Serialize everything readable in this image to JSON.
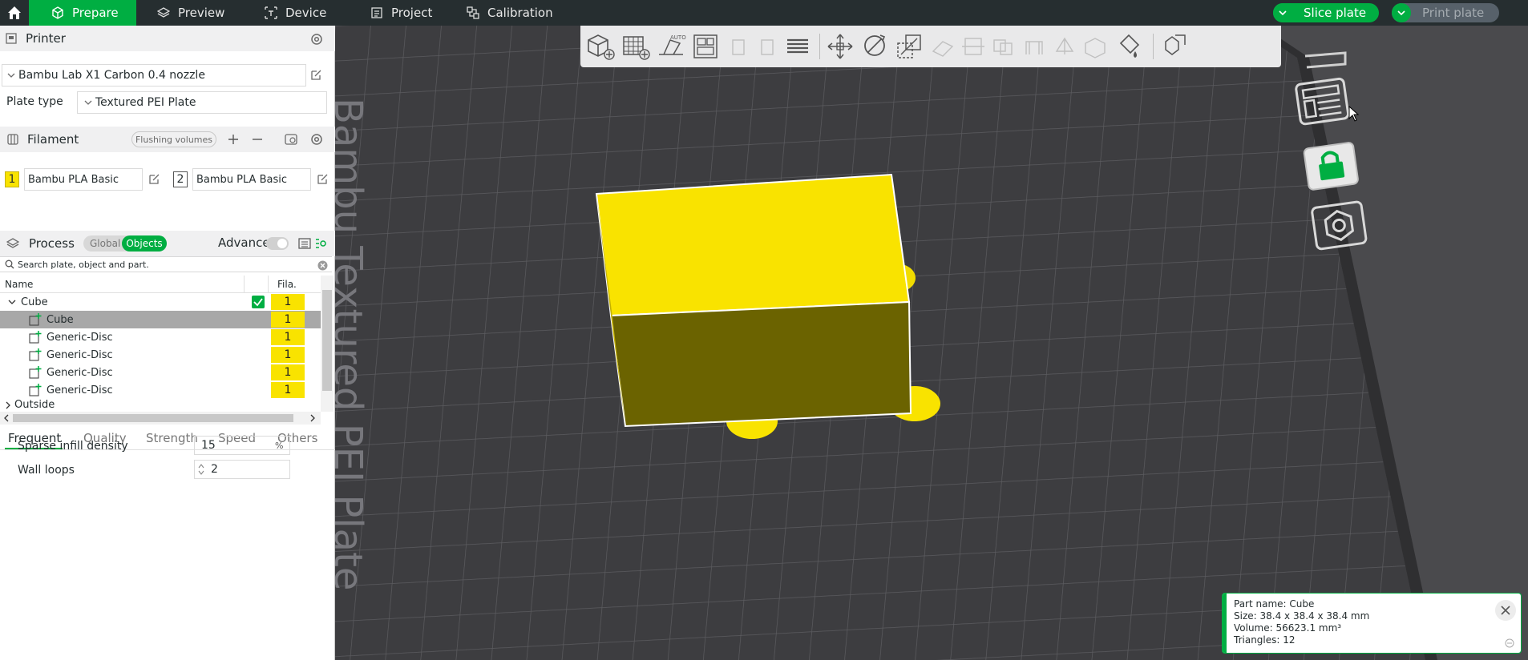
{
  "topbar": {
    "tabs": [
      {
        "label": "Prepare",
        "icon": "cube-icon",
        "active": true
      },
      {
        "label": "Preview",
        "icon": "layers-icon",
        "active": false
      },
      {
        "label": "Device",
        "icon": "printer-icon",
        "active": false
      },
      {
        "label": "Project",
        "icon": "document-icon",
        "active": false
      },
      {
        "label": "Calibration",
        "icon": "calibration-icon",
        "active": false
      }
    ],
    "slice_label": "Slice plate",
    "print_label": "Print plate"
  },
  "printer": {
    "title": "Printer",
    "name": "Bambu Lab X1 Carbon 0.4 nozzle",
    "plate_type_label": "Plate type",
    "plate_type": "Textured PEI Plate"
  },
  "filament": {
    "title": "Filament",
    "flushing_label": "Flushing volumes",
    "slots": [
      {
        "num": "1",
        "name": "Bambu PLA Basic",
        "color": "#f9e300"
      },
      {
        "num": "2",
        "name": "Bambu PLA Basic",
        "color": "#ffffff"
      }
    ]
  },
  "process": {
    "title": "Process",
    "global_label": "Global",
    "objects_label": "Objects",
    "advance_label": "Advance",
    "search_placeholder": "Search plate, object and part."
  },
  "tree": {
    "col_name": "Name",
    "col_fila": "Fila.",
    "object_name": "Cube",
    "object_fila": "1",
    "parts": [
      {
        "name": "Cube",
        "fila": "1",
        "selected": true
      },
      {
        "name": "Generic-Disc",
        "fila": "1",
        "selected": false
      },
      {
        "name": "Generic-Disc",
        "fila": "1",
        "selected": false
      },
      {
        "name": "Generic-Disc",
        "fila": "1",
        "selected": false
      },
      {
        "name": "Generic-Disc",
        "fila": "1",
        "selected": false
      }
    ],
    "outside_label": "Outside"
  },
  "settings": {
    "tabs": [
      "Frequent",
      "Quality",
      "Strength",
      "Speed",
      "Others"
    ],
    "sparse_label": "Sparse infill density",
    "sparse_value": "15",
    "sparse_unit": "%",
    "wall_label": "Wall loops",
    "wall_value": "2"
  },
  "viewport": {
    "plate_text": "Bambu Textured PEI Plate"
  },
  "info": {
    "part_name": "Part name: Cube",
    "size": "Size: 38.4 x 38.4 x 38.4 mm",
    "volume": "Volume: 56623.1 mm³",
    "triangles": "Triangles: 12"
  },
  "colors": {
    "accent": "#00ae42",
    "filament_yellow": "#f9e300",
    "topbar_bg": "#262e30",
    "bed": "#3d3d40"
  }
}
